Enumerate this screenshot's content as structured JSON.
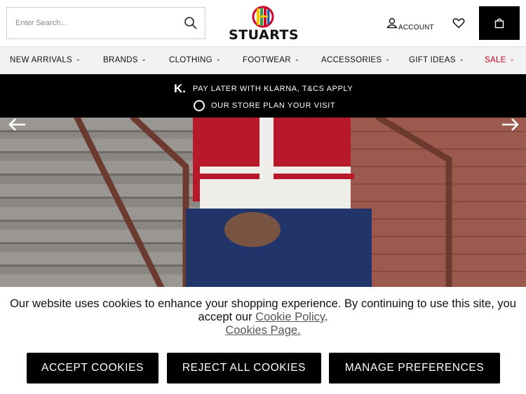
{
  "search": {
    "placeholder": "Enter Search...",
    "icon": "search-icon"
  },
  "brand": {
    "name": "STUARTS",
    "colors": [
      "#d4002a",
      "#f2c500",
      "#2f9e44",
      "#1d5fa8"
    ]
  },
  "header": {
    "account_label": "ACCOUNT",
    "account_icon": "user-icon",
    "wishlist_icon": "heart-icon",
    "bag_icon": "shopping-bag-icon"
  },
  "nav": {
    "items": [
      {
        "label": "NEW ARRIVALS"
      },
      {
        "label": "BRANDS"
      },
      {
        "label": "CLOTHING"
      },
      {
        "label": "FOOTWEAR"
      },
      {
        "label": "ACCESSORIES"
      },
      {
        "label": "GIFT IDEAS"
      },
      {
        "label": "SALE"
      }
    ],
    "sale_color": "#c0001a"
  },
  "promo": {
    "klarna_mark": "K.",
    "line1": "PAY LATER WITH KLARNA, T&CS APPLY",
    "line2": "OUR STORE PLAN YOUR VISIT"
  },
  "hero": {
    "prev_icon": "arrow-left-icon",
    "next_icon": "arrow-right-icon"
  },
  "cookie": {
    "message_part1": "Our website uses cookies to enhance your shopping experience. By continuing to use this site, you accept our ",
    "policy_link": "Cookie Policy",
    "period": ".",
    "page_link": "Cookies Page.",
    "accept": "ACCEPT COOKIES",
    "reject": "REJECT ALL COOKIES",
    "manage": "MANAGE PREFERENCES"
  }
}
